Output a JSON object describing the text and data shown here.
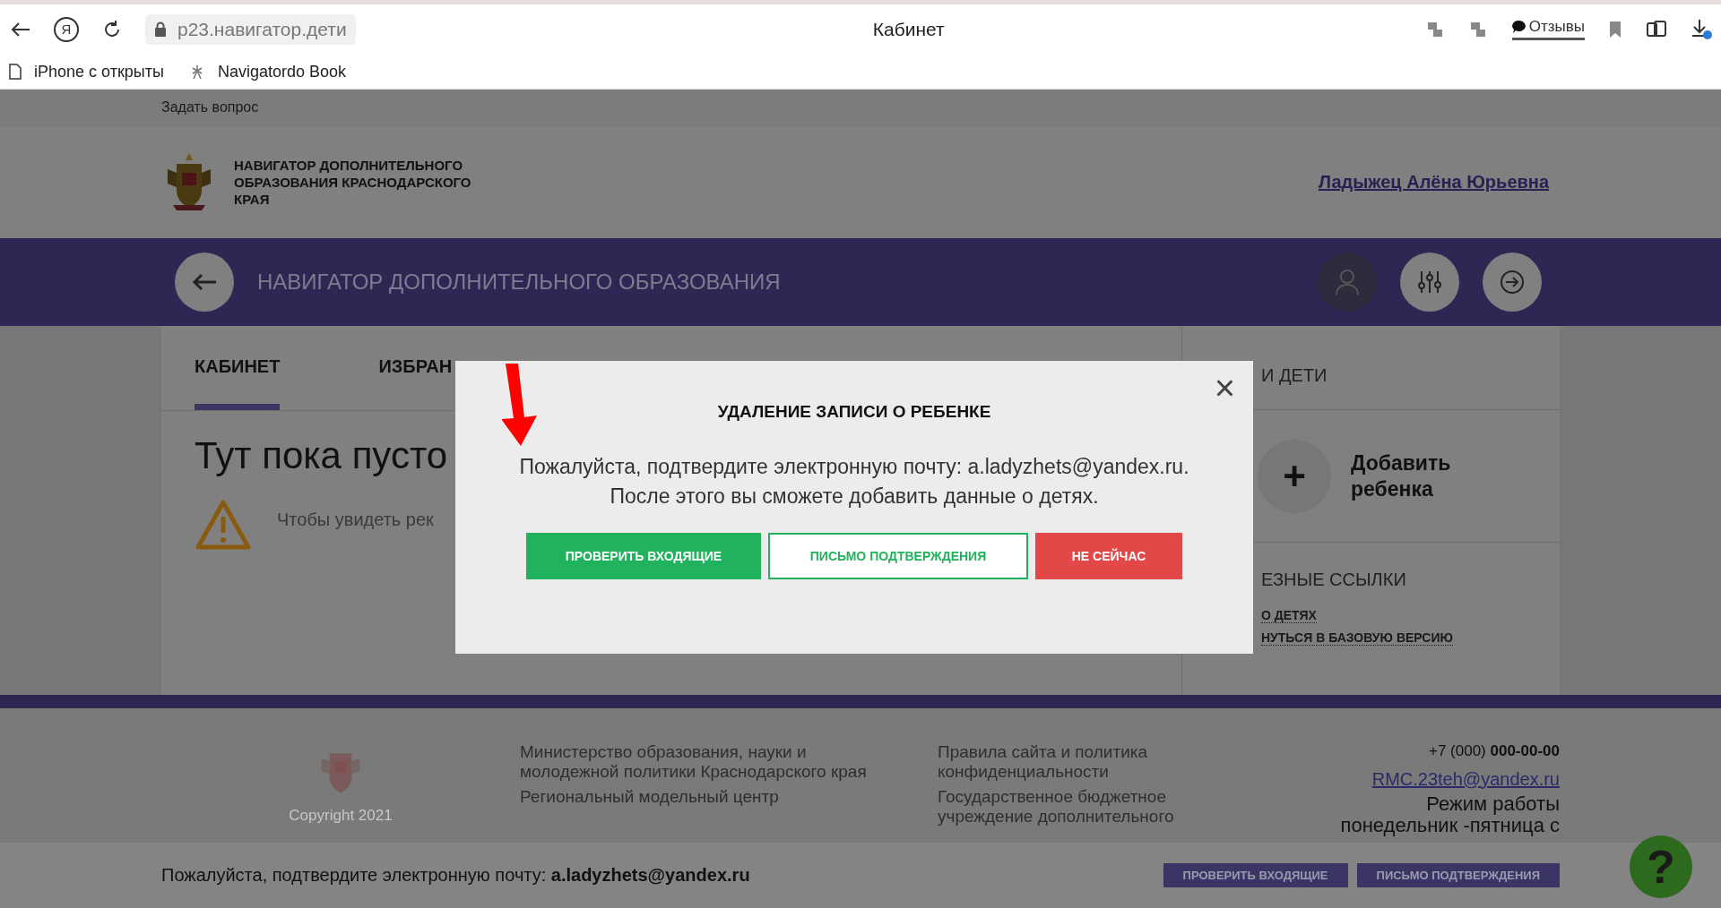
{
  "browser": {
    "yandex_logo": "Я",
    "url": "p23.навигатор.дети",
    "title": "Кабинет",
    "reviews": "Отзывы",
    "bookmarks": [
      "iPhone с открыты",
      "Navigatordo Book"
    ]
  },
  "top_link": "Задать вопрос",
  "header": {
    "org_title": "НАВИГАТОР ДОПОЛНИТЕЛЬНОГО ОБРАЗОВАНИЯ КРАСНОДАРСКОГО КРАЯ",
    "user": "Ладыжец Алёна Юрьевна"
  },
  "nav": {
    "title": "НАВИГАТОР ДОПОЛНИТЕЛЬНОГО ОБРАЗОВАНИЯ"
  },
  "tabs": [
    {
      "label": "КАБИНЕТ",
      "selected": true
    },
    {
      "label": "ИЗБРАН",
      "selected": false
    }
  ],
  "main": {
    "heading": "Тут пока пусто",
    "notice": "Чтобы увидеть рек"
  },
  "side": {
    "heading": "И ДЕТИ",
    "add_child": "Добавить ребенка",
    "plus": "+",
    "links_heading": "ЕЗНЫЕ ССЫЛКИ",
    "links": [
      "О ДЕТЯХ",
      "НУТЬСЯ В БАЗОВУЮ ВЕРСИЮ"
    ]
  },
  "modal": {
    "close": "×",
    "title": "УДАЛЕНИЕ ЗАПИСИ О РЕБЕНКЕ",
    "text": "Пожалуйста, подтвердите электронную почту: a.ladyzhets@yandex.ru. После этого вы сможете добавить данные о детях.",
    "buttons": [
      {
        "label": "ПРОВЕРИТЬ ВХОДЯЩИЕ",
        "kind": "primary"
      },
      {
        "label": "ПИСЬМО ПОДТВЕРЖДЕНИЯ",
        "kind": "outline"
      },
      {
        "label": "НЕ СЕЙЧАС",
        "kind": "danger"
      }
    ]
  },
  "footer": {
    "copyright": "Copyright 2021",
    "col_2": [
      "Министерство образования, науки и молодежной политики Краснодарского края",
      "Региональный модельный центр"
    ],
    "col_3": [
      "Правила сайта и политика конфиденциальности",
      "Государственное бюджетное учреждение дополнительного"
    ],
    "phone": "+7 (000) **000-00-00**",
    "email": "RMC.23teh@yandex.ru",
    "hours": [
      "Режим работы",
      "понедельник -пятница с"
    ]
  },
  "bottom_bar": {
    "text": "Пожалуйста, подтвердите электронную почту: **a.ladyzhets@yandex.ru**",
    "buttons": [
      "ПРОВЕРИТЬ ВХОДЯЩИЕ",
      "ПИСЬМО ПОДТВЕРЖДЕНИЯ"
    ]
  },
  "help": "?"
}
